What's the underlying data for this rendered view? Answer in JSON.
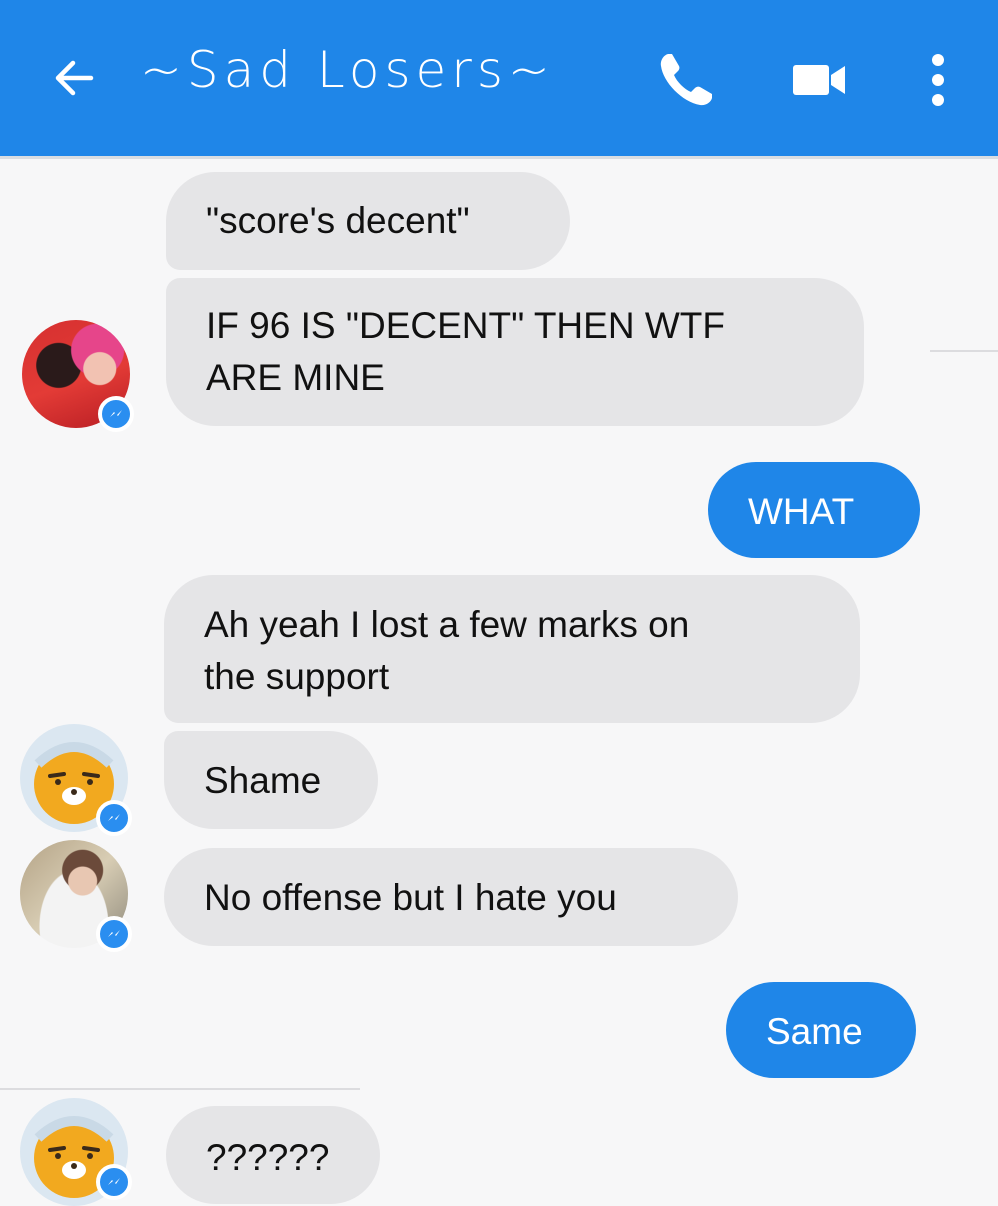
{
  "header": {
    "title": "~Sad Losers~",
    "back_icon": "back-arrow-icon",
    "call_icon": "phone-icon",
    "video_icon": "video-camera-icon",
    "more_icon": "more-vertical-icon"
  },
  "colors": {
    "header": "#1f86e8",
    "incoming_bubble": "#e5e5e7",
    "outgoing_bubble": "#1f86e8",
    "background": "#f7f7f8"
  },
  "messages": [
    {
      "direction": "incoming",
      "text": "\"score's decent\""
    },
    {
      "direction": "incoming",
      "line1": "IF 96 IS \"DECENT\" THEN WTF",
      "line2": "ARE MINE"
    },
    {
      "direction": "outgoing",
      "text": "WHAT"
    },
    {
      "direction": "incoming",
      "line1": "Ah yeah I lost a few marks on",
      "line2": "the support"
    },
    {
      "direction": "incoming",
      "text": "Shame"
    },
    {
      "direction": "incoming",
      "text": "No offense but I hate you"
    },
    {
      "direction": "outgoing",
      "text": "Same"
    },
    {
      "direction": "incoming",
      "text": "??????"
    }
  ]
}
